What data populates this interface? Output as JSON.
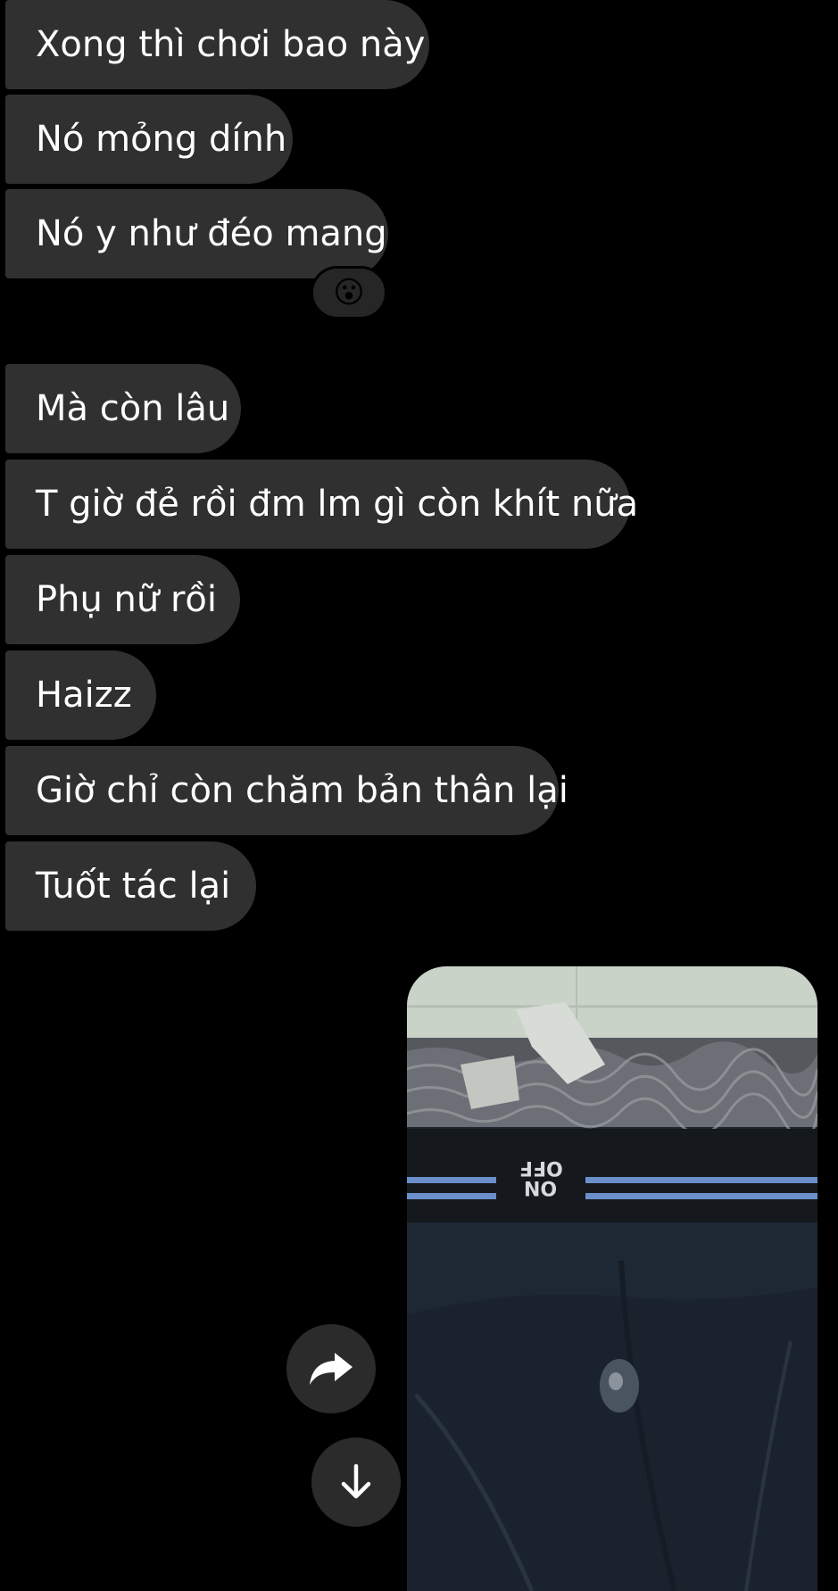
{
  "messages": [
    {
      "text": "Xong thì chơi bao này"
    },
    {
      "text": "Nó mỏng dính"
    },
    {
      "text": "Nó y như đéo mang"
    },
    {
      "text": "Mà còn lâu"
    },
    {
      "text": "T giờ đẻ rồi đm lm gì còn khít nữa"
    },
    {
      "text": "Phụ nữ rồi"
    },
    {
      "text": "Haizz"
    },
    {
      "text": "Giờ chỉ còn chăm bản thân lại"
    },
    {
      "text": "Tuốt tác lại"
    }
  ],
  "reaction": {
    "emoji": "😮",
    "icon": "astonished-face-icon"
  },
  "photo": {
    "label_top": "OFF",
    "label_bottom": "ON",
    "colors": {
      "tile": "#c9d3c8",
      "fabric": "#1e2834",
      "stripe": "#6b8fc9"
    }
  },
  "controls": {
    "forward_icon": "share-arrow-icon",
    "scroll_icon": "arrow-down-icon"
  },
  "colors": {
    "background": "#000000",
    "bubble": "#303030",
    "text": "#ffffff",
    "button": "#2b2b2b"
  }
}
